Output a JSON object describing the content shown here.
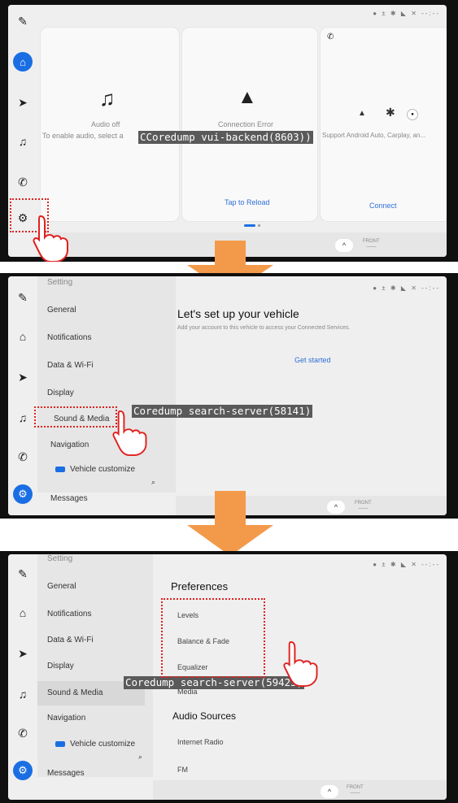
{
  "colors": {
    "accent": "#1a6ee3",
    "highlight": "#e0211f",
    "arrow": "#f39a4a",
    "link": "#2e6fd8"
  },
  "rail_icons": [
    "wrench-icon",
    "home-icon",
    "navigation-arrow-icon",
    "music-note-icon",
    "phone-icon",
    "gear-icon"
  ],
  "status_bar": {
    "text": "● ± ✱ ◣ ✕ --:--"
  },
  "bottom_bar": {
    "chevron": "^",
    "front_line1": "FRONT",
    "front_line2": "——"
  },
  "panel1": {
    "cards": {
      "audio": {
        "status": "Audio off",
        "hint": "To enable audio, select a"
      },
      "connection": {
        "title": "Connection Error",
        "action": "Tap to Reload"
      },
      "phone": {
        "hint": "Support Android Auto, Carplay, an...",
        "action": "Connect"
      }
    },
    "overlay": "CCoredump vui-backend(8603))"
  },
  "panel2": {
    "settings_title": "Setting",
    "menu": [
      "General",
      "Notifications",
      "Data & Wi-Fi",
      "Display",
      "Sound & Media",
      "Navigation",
      "Vehicle customize",
      "Messages"
    ],
    "main": {
      "title": "Let's set up your vehicle",
      "subtitle": "Add your account to this vehicle to access your Connected Services.",
      "action": "Get started"
    },
    "overlay": "Coredump search-server(58141)"
  },
  "panel3": {
    "settings_title": "Setting",
    "menu": [
      "General",
      "Notifications",
      "Data & Wi-Fi",
      "Display",
      "Sound & Media",
      "Navigation",
      "Vehicle customize",
      "Messages"
    ],
    "preferences_heading": "Preferences",
    "preferences": [
      "Levels",
      "Balance & Fade",
      "Equalizer",
      "Media"
    ],
    "audio_sources_heading": "Audio Sources",
    "audio_sources": [
      "Internet Radio",
      "FM"
    ],
    "overlay": "Coredump search-server(59425)"
  }
}
